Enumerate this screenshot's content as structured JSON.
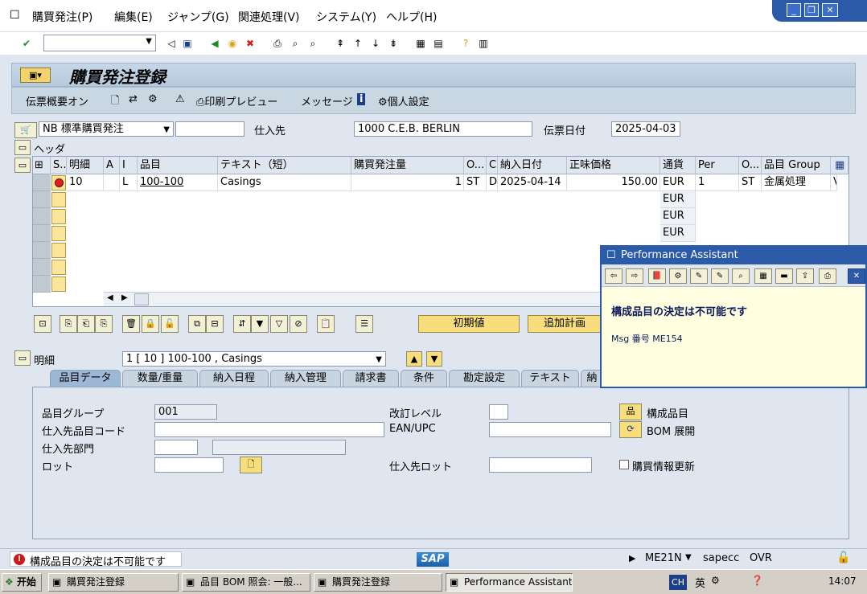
{
  "menubar": {
    "items": [
      "購買発注(P)",
      "編集(E)",
      "ジャンプ(G)",
      "関連処理(V)",
      "システム(Y)",
      "ヘルプ(H)"
    ]
  },
  "title": "購買発注登録",
  "app_toolbar": {
    "doc_overview": "伝票概要オン",
    "print_preview": "印刷プレビュー",
    "messages": "メッセージ",
    "personal_settings": "個人設定"
  },
  "header": {
    "doc_type": "NB 標準購買発注",
    "vendor_label": "仕入先",
    "vendor_value": "1000 C.E.B. BERLIN",
    "doc_date_label": "伝票日付",
    "doc_date_value": "2025-04-03",
    "header_label": "ヘッダ"
  },
  "grid": {
    "headers": [
      "S...",
      "明細",
      "A",
      "I",
      "品目",
      "テキスト（短）",
      "購買発注量",
      "O...",
      "C",
      "納入日付",
      "正味価格",
      "通貨",
      "Per",
      "O...",
      "品目 Group",
      "I"
    ],
    "row1": {
      "item": "10",
      "i": "L",
      "material": "100-100",
      "text": "Casings",
      "qty": "1",
      "uom": "ST",
      "c": "D",
      "date": "2025-04-14",
      "price": "150.00",
      "currency": "EUR",
      "per": "1",
      "opu": "ST",
      "matgroup": "金属処理",
      "v": "V"
    },
    "empty_currency": "EUR"
  },
  "buttons": {
    "defaults": "初期値",
    "additional_planning": "追加計画"
  },
  "item_section": {
    "label": "明細",
    "selected": "1 [ 10 ] 100-100 , Casings"
  },
  "tabs": [
    "品目データ",
    "数量/重量",
    "納入日程",
    "納入管理",
    "請求書",
    "条件",
    "勘定設定",
    "テキスト",
    "納"
  ],
  "item_fields": {
    "material_group_label": "品目グループ",
    "material_group_value": "001",
    "vendor_material_label": "仕入先品目コード",
    "vendor_subrange_label": "仕入先部門",
    "batch_label": "ロット",
    "revision_label": "改訂レベル",
    "ean_label": "EAN/UPC",
    "vendor_batch_label": "仕入先ロット",
    "components_label": "構成品目",
    "bom_explode_label": "BOM 展開",
    "info_update_label": "購買情報更新"
  },
  "statusbar": {
    "message": "構成品目の決定は不可能です",
    "tcode": "ME21N",
    "server": "sapecc",
    "mode": "OVR"
  },
  "performance_assistant": {
    "title": "Performance Assistant",
    "heading": "構成品目の決定は不可能です",
    "msg": "Msg 番号 ME154"
  },
  "taskbar": {
    "start": "开始",
    "tasks": [
      "購買発注登録",
      "品目 BOM 照会: 一般...",
      "購買発注登録",
      "Performance Assistant"
    ],
    "lang": "CH",
    "ime": "英",
    "clock": "14:07"
  }
}
